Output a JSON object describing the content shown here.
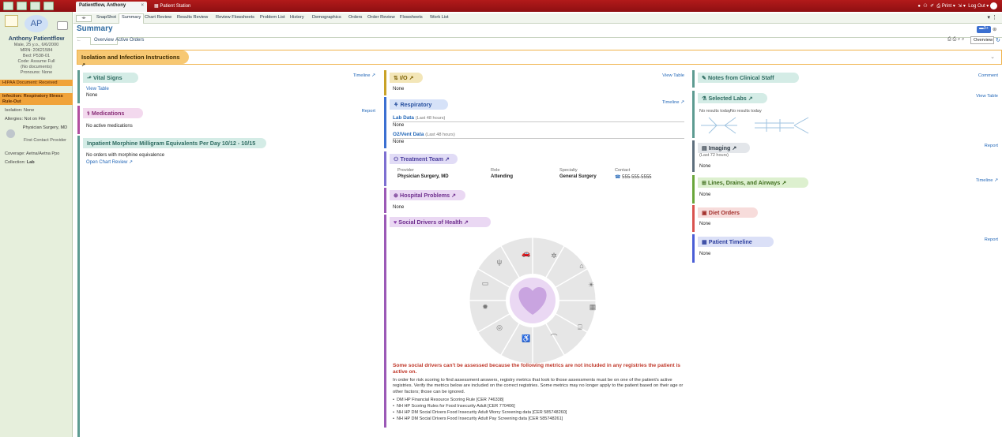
{
  "topbar": {
    "patient_tab": "Patientflow, Anthony",
    "station_tab": "Patient Station",
    "print": "Print",
    "logout": "Log Out"
  },
  "sidebar": {
    "initials": "AP",
    "name": "Anthony Patientflow",
    "lines": [
      "Male, 25 y.o., 6/6/2000",
      "MRN: 20621584",
      "Bed: P538-01",
      "Code: Assume Full",
      "(No documents)",
      "Pronouns: None"
    ],
    "hipaa": "HIPAA Document: Received",
    "infection": "Infection: Respiratory Illness Rule-Out",
    "isolation": "Isolation: None",
    "allergies": "Allergies: Not on File",
    "provider_name": "Physician Surgery, MD",
    "provider_role": "First Contact Provider",
    "coverage": "Coverage: Aetna/Aetna Ppo",
    "collection_label": "Collection:",
    "collection_value": "Lab"
  },
  "tabs": [
    "SnapShot",
    "Summary",
    "Chart Review",
    "Results Review",
    "Review Flowsheets",
    "Problem List",
    "History",
    "Demographics",
    "Orders",
    "Order Review",
    "Flowsheets",
    "Work List"
  ],
  "header": {
    "title": "Summary",
    "subtab_overview": "Overview",
    "subtab_orders": "Active Orders",
    "search_value": "Overview"
  },
  "isolation_banner": "Isolation and Infection Instructions",
  "vitals": {
    "title": "Vital Signs",
    "link": "Timeline",
    "view": "View Table",
    "value": "None"
  },
  "medications": {
    "title": "Medications",
    "link": "Report",
    "value": "No active medications"
  },
  "morphine": {
    "title": "Inpatient Morphine Milligram Equivalents Per Day 10/12 - 10/15",
    "value": "No orders with morphine equivalence",
    "link": "Open Chart Review"
  },
  "io": {
    "title": "I/O",
    "link": "View Table",
    "value": "None"
  },
  "respiratory": {
    "title": "Respiratory",
    "link": "Timeline",
    "lab_label": "Lab Data",
    "lab_sub": "(Last 48 hours)",
    "lab_value": "None",
    "vent_label": "O2/Vent Data",
    "vent_sub": "(Last 48 hours)",
    "vent_value": "None"
  },
  "team": {
    "title": "Treatment Team",
    "headers": [
      "Provider",
      "Role",
      "Specialty",
      "Contact"
    ],
    "row": [
      "Physician Surgery, MD",
      "Attending",
      "General Surgery",
      "555-555-5555"
    ]
  },
  "problems": {
    "title": "Hospital Problems",
    "value": "None"
  },
  "sdoh": {
    "title": "Social Drivers of Health",
    "warning": "Some social drivers can't be assessed because the following metrics are not included in any registries the patient is active on.",
    "body": "In order for risk scoring to find assessment answers, registry metrics that look to those assessments must be on one of the patient's active registries. Verify the metrics below are included on the correct registries. Some metrics may no longer apply to the patient based on their age or other factors; those can be ignored.",
    "bullets": [
      "DM HP Financial Resource Scoring Rule [CER 746338]",
      "NH HP Scoring Rules for Food Insecurity Adult [CER 770406]",
      "NH HP DM Social Drivers Food Insecurity Adult Worry Screening data [CER 585748260]",
      "NH HP DM Social Drivers Food Insecurity Adult Pay Screening data [CER 585748261]"
    ]
  },
  "notes": {
    "title": "Notes from Clinical Staff",
    "link": "Comment"
  },
  "labs": {
    "title": "Selected Labs",
    "link": "View Table",
    "no1": "No results today",
    "no2": "No results today"
  },
  "imaging": {
    "title": "Imaging",
    "sub": "(Last 72 hours)",
    "link": "Report",
    "value": "None"
  },
  "lda": {
    "title": "Lines, Drains, and Airways",
    "link": "Timeline",
    "value": "None"
  },
  "diet": {
    "title": "Diet Orders",
    "value": "None"
  },
  "ptimeline": {
    "title": "Patient Timeline",
    "link": "Report",
    "value": "None"
  },
  "colors": {
    "topbar": "#a3161a",
    "sidebar": "#e6efdc",
    "teal": "#5d9b91",
    "purple": "#9b59b6",
    "red": "#d9534f",
    "blue": "#3b6fd1",
    "gold": "#c9a227"
  }
}
